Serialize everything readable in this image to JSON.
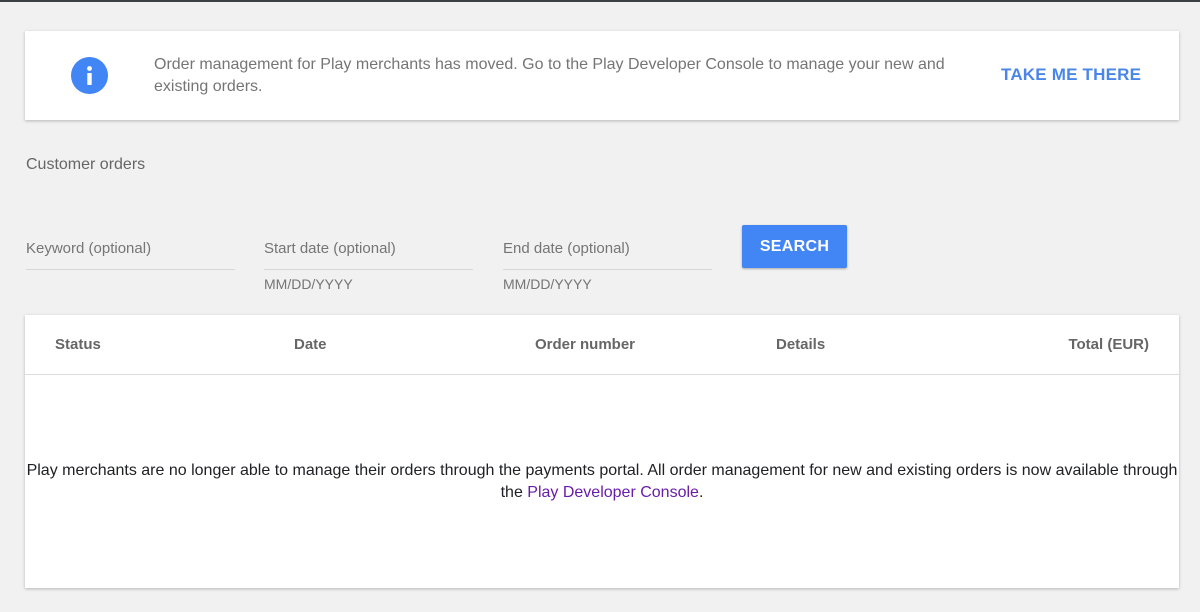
{
  "banner": {
    "icon": "info-icon",
    "message": "Order management for Play merchants has moved. Go to the Play Developer Console to manage your new and existing orders.",
    "action_label": "TAKE ME THERE"
  },
  "page": {
    "title": "Customer orders"
  },
  "filters": {
    "keyword": {
      "label": "Keyword (optional)",
      "value": ""
    },
    "start_date": {
      "label": "Start date (optional)",
      "hint": "MM/DD/YYYY",
      "value": ""
    },
    "end_date": {
      "label": "End date (optional)",
      "hint": "MM/DD/YYYY",
      "value": ""
    },
    "search_label": "SEARCH"
  },
  "table": {
    "columns": [
      "Status",
      "Date",
      "Order number",
      "Details",
      "Total (EUR)"
    ],
    "rows": [],
    "empty_message_before": "Play merchants are no longer able to manage their orders through the payments portal. All order management for new and existing orders is now available through the ",
    "empty_message_link": "Play Developer Console",
    "empty_message_after": "."
  },
  "colors": {
    "accent": "#4285f4",
    "link_visited": "#681da8",
    "background": "#f1f1f1"
  }
}
